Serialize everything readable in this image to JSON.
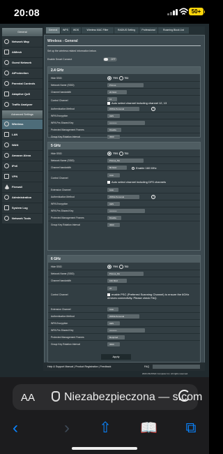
{
  "status": {
    "time": "20:08",
    "battery": "50+"
  },
  "browser": {
    "text_size_label": "AA",
    "security_label": "Niezabezpieczona —",
    "url_suffix": "s.com",
    "toolbar": {
      "back": "‹",
      "forward": "›",
      "share": "⇧",
      "bookmarks": "📖",
      "tabs": "⧉"
    }
  },
  "sidebar": {
    "groups": [
      "General",
      "Advanced Settings"
    ],
    "items": [
      {
        "label": "Network Map",
        "icon": "network-map-icon"
      },
      {
        "label": "AiMesh",
        "icon": "mesh-icon"
      },
      {
        "label": "Guest Network",
        "icon": "guest-network-icon"
      },
      {
        "label": "AiProtection",
        "icon": "shield-icon"
      },
      {
        "label": "Parental Controls",
        "icon": "parental-controls-icon"
      },
      {
        "label": "Adaptive QoS",
        "icon": "qos-icon"
      },
      {
        "label": "Traffic Analyzer",
        "icon": "traffic-analyzer-icon"
      },
      {
        "label": "Wireless",
        "icon": "wireless-icon"
      },
      {
        "label": "LAN",
        "icon": "lan-icon"
      },
      {
        "label": "WAN",
        "icon": "wan-icon"
      },
      {
        "label": "Amazon Alexa",
        "icon": "alexa-icon"
      },
      {
        "label": "IPv6",
        "icon": "ipv6-icon"
      },
      {
        "label": "VPN",
        "icon": "vpn-icon"
      },
      {
        "label": "Firewall",
        "icon": "firewall-icon"
      },
      {
        "label": "Administration",
        "icon": "administration-icon"
      },
      {
        "label": "System Log",
        "icon": "system-log-icon"
      },
      {
        "label": "Network Tools",
        "icon": "network-tools-icon"
      }
    ]
  },
  "tabs": [
    "General",
    "WPS",
    "WDS",
    "Wireless MAC Filter",
    "RADIUS Setting",
    "Professional",
    "Roaming Block List"
  ],
  "page": {
    "title": "Wireless - General",
    "description": "Set up the wireless related information below.",
    "smart_connect_label": "Enable Smart Connect",
    "smart_connect_state": "OFF",
    "apply": "Apply"
  },
  "bands": [
    {
      "name": "2.4 GHz",
      "fields": [
        {
          "label": "Hide SSID",
          "type": "radio",
          "yes": "Yes",
          "no": "No"
        },
        {
          "label": "Network Name (SSID)",
          "value": "Primus"
        },
        {
          "label": "Channel bandwidth",
          "value": "20 MHz"
        },
        {
          "label": "Control Channel",
          "value": "11",
          "note": "Auto select channel including channel 12, 13"
        },
        {
          "label": "Authentication Method",
          "value": "WPA2-Personal"
        },
        {
          "label": "WPA Encryption",
          "value": "AES"
        },
        {
          "label": "WPA Pre-Shared Key",
          "value": "••••••••••"
        },
        {
          "label": "Protected Management Frames",
          "value": "Disable"
        },
        {
          "label": "Group Key Rotation Interval",
          "value": "3600"
        }
      ]
    },
    {
      "name": "5 GHz",
      "fields": [
        {
          "label": "Hide SSID",
          "type": "radio",
          "yes": "Yes",
          "no": "No"
        },
        {
          "label": "Network Name (SSID)",
          "value": "Primus_5G"
        },
        {
          "label": "Channel bandwidth",
          "value": "80 MHz",
          "note": "Enable 160 MHz"
        },
        {
          "label": "Control Channel",
          "value": "Auto",
          "note": "Auto select channel including DFS channels"
        },
        {
          "label": "Extension Channel",
          "value": "Auto"
        },
        {
          "label": "Authentication Method",
          "value": "WPA2-Personal"
        },
        {
          "label": "WPA Encryption",
          "value": "AES"
        },
        {
          "label": "WPA Pre-Shared Key",
          "value": "••••••••••"
        },
        {
          "label": "Protected Management Frames",
          "value": "Disable"
        },
        {
          "label": "Group Key Rotation Interval",
          "value": "3600"
        }
      ]
    },
    {
      "name": "6 GHz",
      "fields": [
        {
          "label": "Hide SSID",
          "type": "radio",
          "yes": "Yes",
          "no": "No"
        },
        {
          "label": "Network Name (SSID)",
          "value": "Primus_6G"
        },
        {
          "label": "Channel bandwidth",
          "value": "160 MHz"
        },
        {
          "label": "Control Channel",
          "value": "37",
          "note": "enable PSC (Preferred Scanning Channel) to ensure the 6GHz devices connectivity. Please check FAQ."
        },
        {
          "label": "Extension Channel",
          "value": "Auto"
        },
        {
          "label": "Authentication Method",
          "value": "WPA3-Personal"
        },
        {
          "label": "WPA Encryption",
          "value": "AES"
        },
        {
          "label": "WPA Pre-Shared Key",
          "value": "••••••••••"
        },
        {
          "label": "Protected Management Frames",
          "value": "Required"
        },
        {
          "label": "Group Key Rotation Interval",
          "value": "3600"
        }
      ]
    }
  ],
  "footer": {
    "help": "Help & Support",
    "links": "Manual | Product Registration | Feedback",
    "faq": "FAQ",
    "copyright": "2023 ASUSTeK Computer Inc. All rights reserved."
  },
  "colors": {
    "accent": "#0a84ff",
    "battery": "#ffd60a",
    "router_bg": "#2d373b"
  }
}
